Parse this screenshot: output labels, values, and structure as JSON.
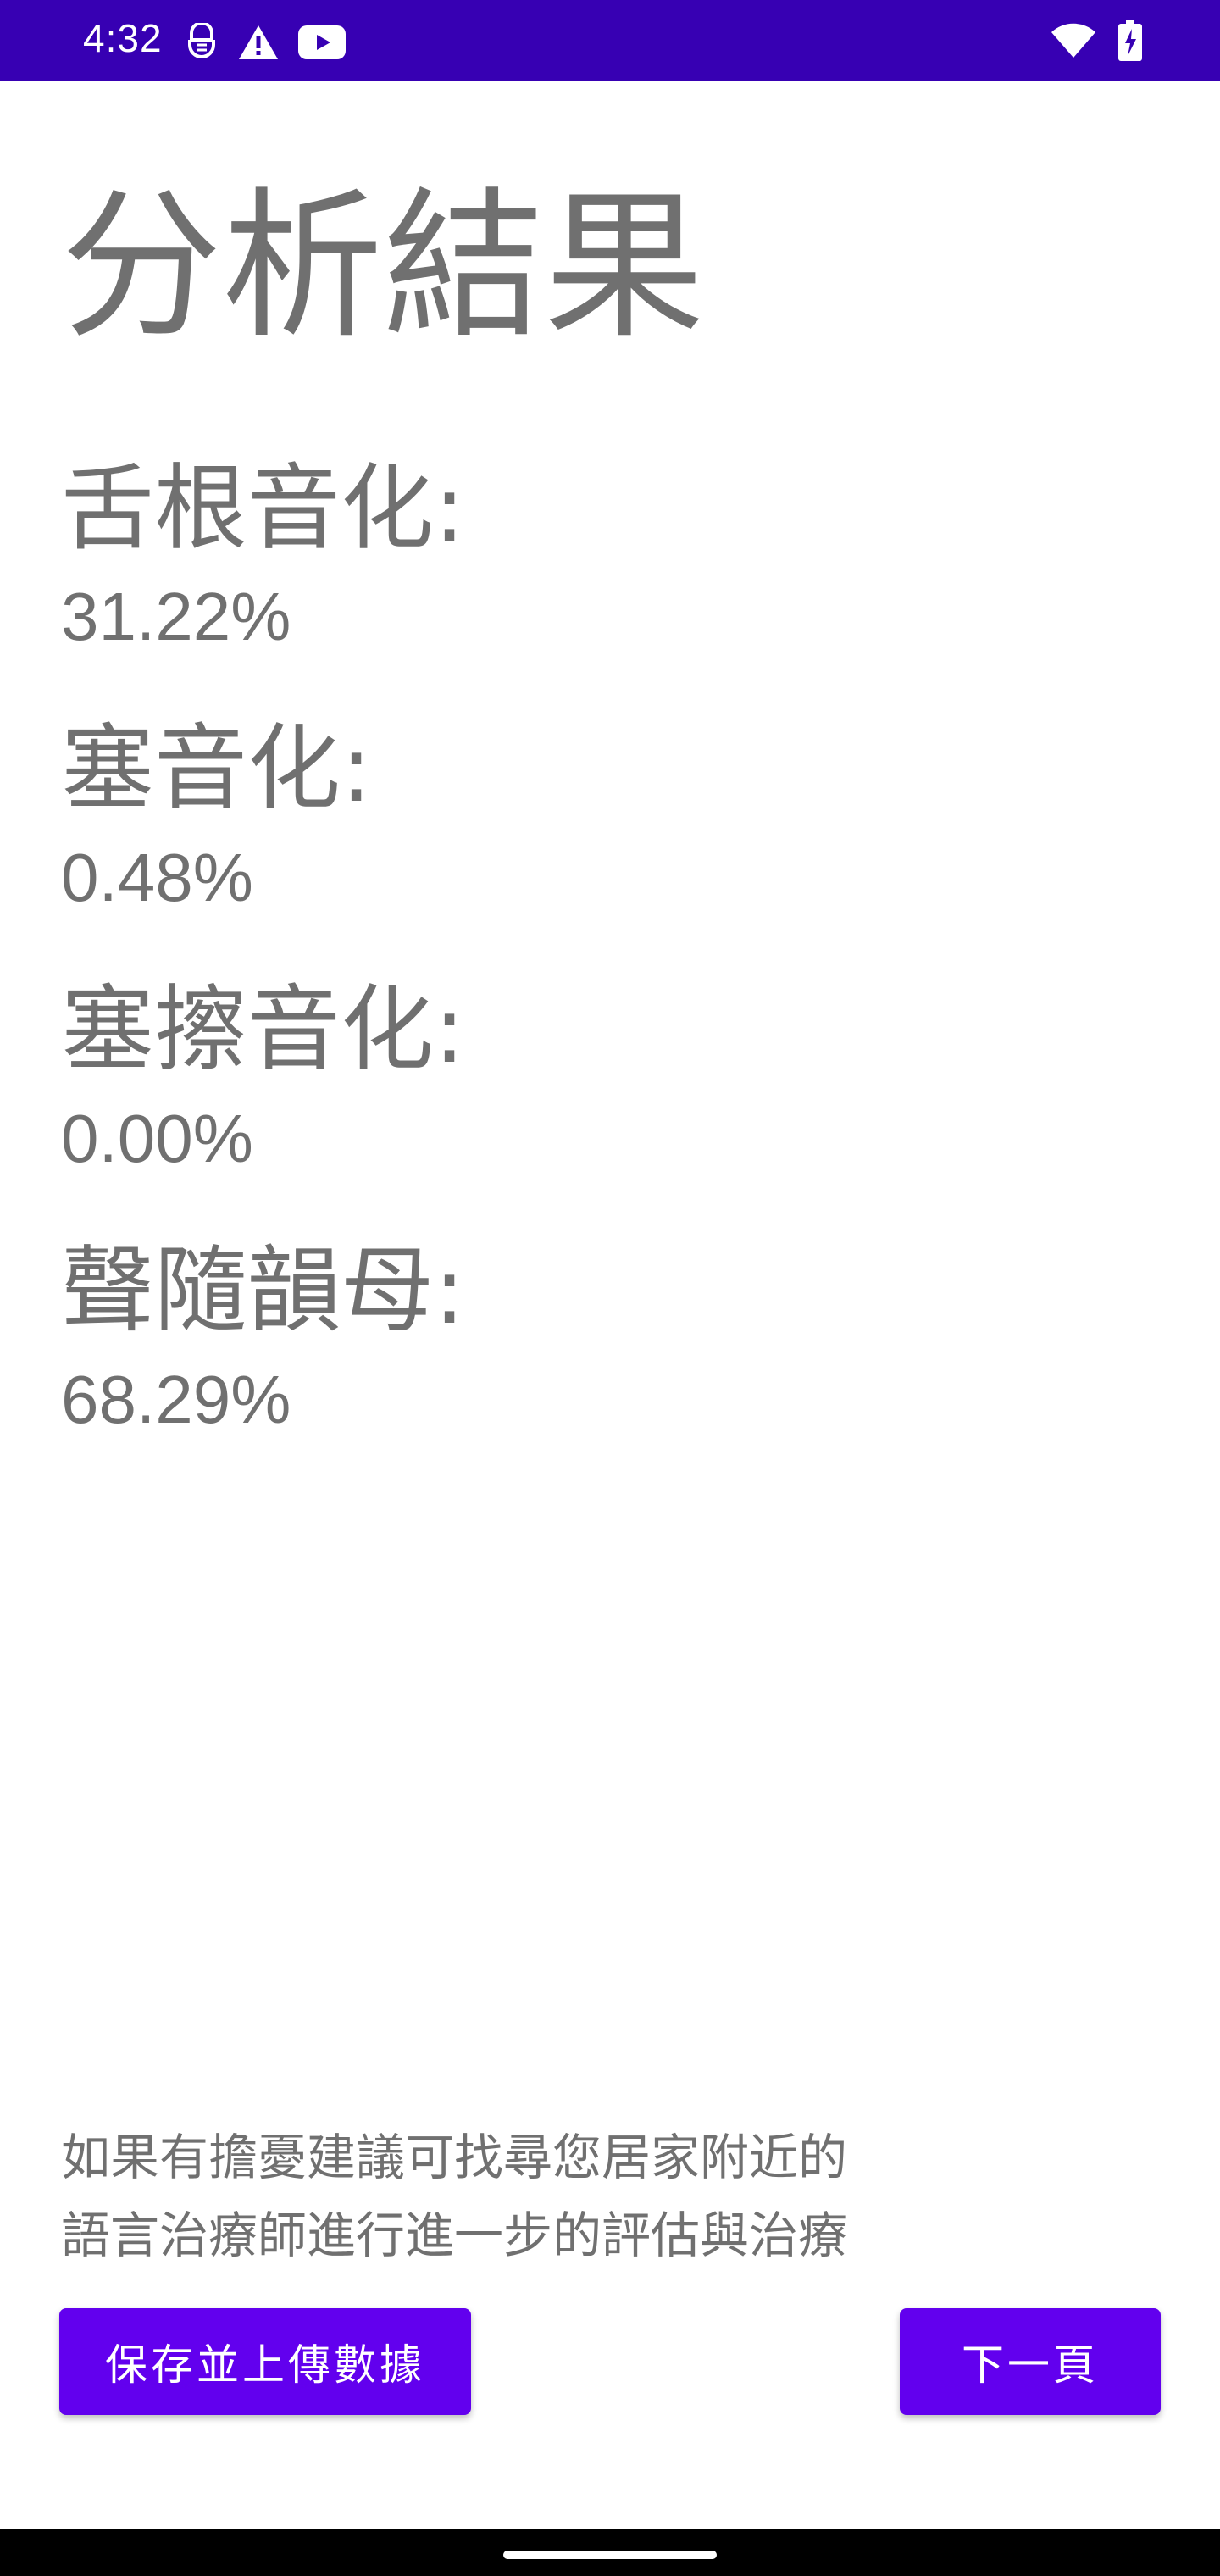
{
  "status_bar": {
    "time": "4:32",
    "background_color": "#3700b3",
    "left_icons": [
      "keyboard-lock-icon",
      "warning-icon",
      "youtube-icon"
    ],
    "right_icons": [
      "wifi-icon",
      "battery-charging-icon"
    ]
  },
  "page": {
    "title": "分析結果"
  },
  "metrics": [
    {
      "label": "舌根音化:",
      "value": "31.22%"
    },
    {
      "label": "塞音化:",
      "value": "0.48%"
    },
    {
      "label": "塞擦音化:",
      "value": "0.00%"
    },
    {
      "label": "聲隨韻母:",
      "value": "68.29%"
    }
  ],
  "advice": {
    "line1": "如果有擔憂建議可找尋您居家附近的",
    "line2": "語言治療師進行進一步的評估與治療"
  },
  "buttons": {
    "save_upload_label": "保存並上傳數據",
    "next_page_label": "下一頁",
    "accent_color": "#6200ee"
  }
}
